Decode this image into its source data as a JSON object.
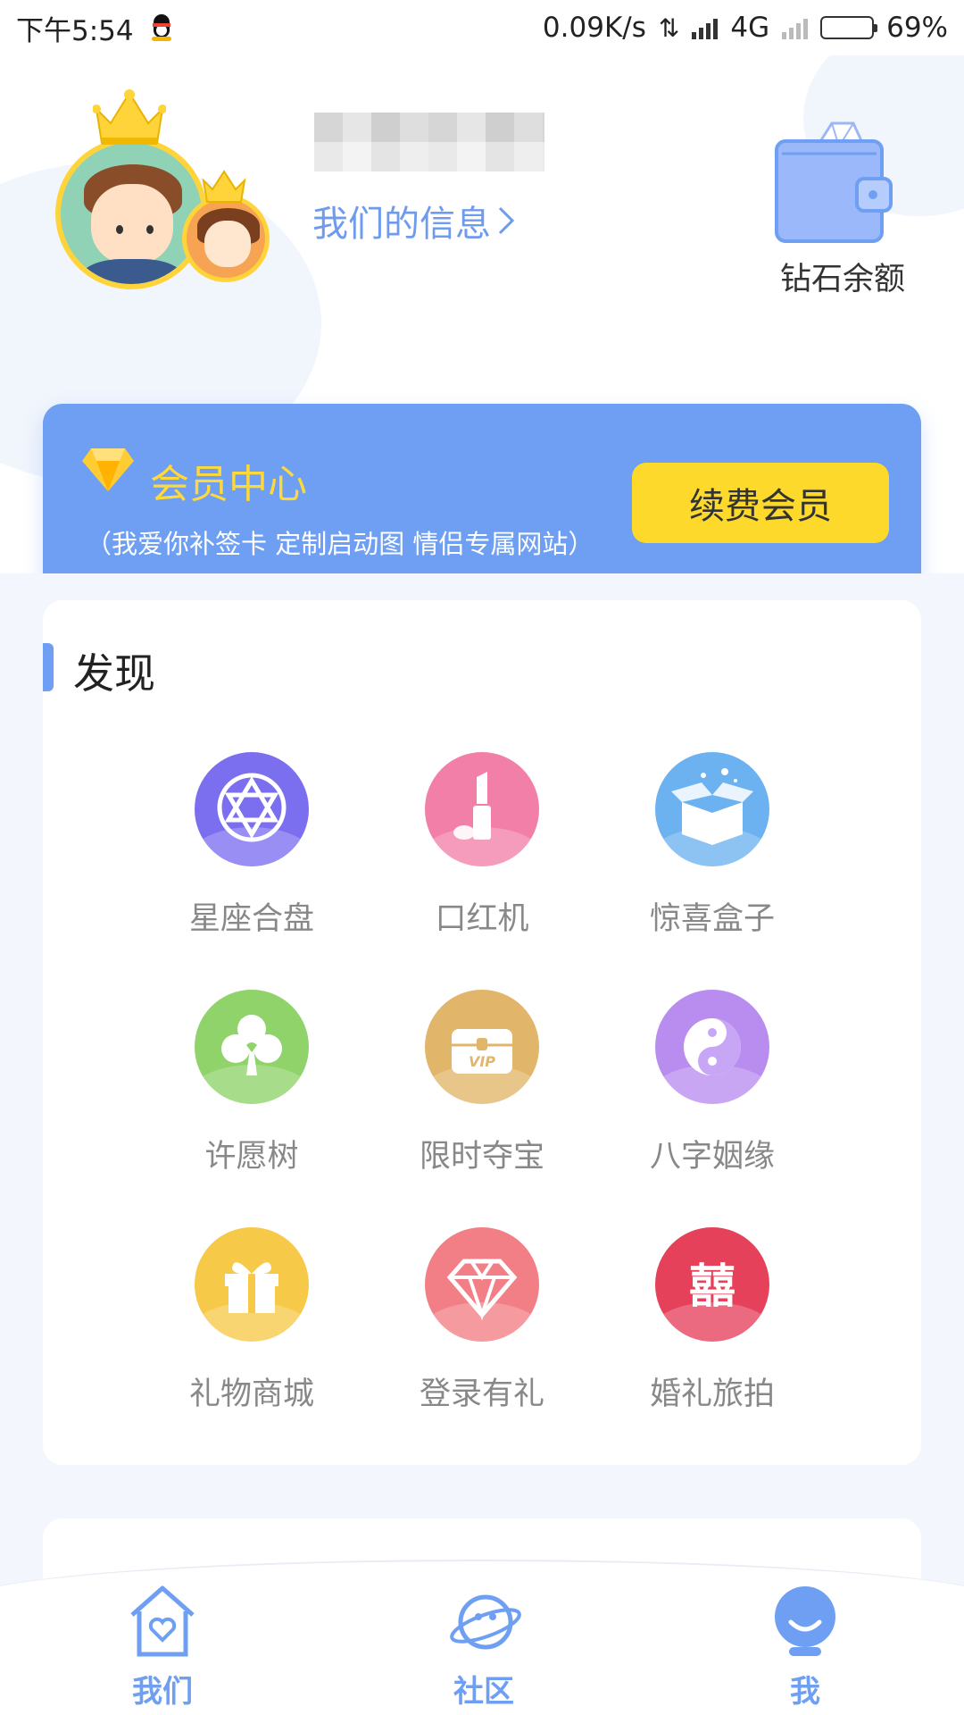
{
  "status_bar": {
    "time": "下午5:54",
    "net_speed": "0.09K/s",
    "network_type": "4G",
    "battery": "69%",
    "battery_level": 0.69
  },
  "profile": {
    "info_link": "我们的信息",
    "wallet_label": "钻石余额"
  },
  "member": {
    "title": "会员中心",
    "subtitle": "（我爱你补签卡 定制启动图 情侣专属网站）",
    "renew_button": "续费会员"
  },
  "discover": {
    "title": "发现",
    "items": [
      {
        "label": "星座合盘",
        "icon": "star-of-david-icon",
        "color": "#7b6ff0"
      },
      {
        "label": "口红机",
        "icon": "lipstick-icon",
        "color": "#f27fa8"
      },
      {
        "label": "惊喜盒子",
        "icon": "gift-box-open-icon",
        "color": "#6cb2f0"
      },
      {
        "label": "许愿树",
        "icon": "clover-icon",
        "color": "#8fd36a"
      },
      {
        "label": "限时夺宝",
        "icon": "vip-chest-icon",
        "color": "#e2b66a"
      },
      {
        "label": "八字姻缘",
        "icon": "yin-yang-icon",
        "color": "#b98df0"
      },
      {
        "label": "礼物商城",
        "icon": "gift-icon",
        "color": "#f7c948"
      },
      {
        "label": "登录有礼",
        "icon": "diamond-icon",
        "color": "#f27f86"
      },
      {
        "label": "婚礼旅拍",
        "icon": "double-happiness-icon",
        "color": "#e6415b"
      }
    ]
  },
  "bottom_nav": {
    "items": [
      {
        "label": "我们",
        "icon": "house-heart-icon"
      },
      {
        "label": "社区",
        "icon": "planet-icon"
      },
      {
        "label": "我",
        "icon": "profile-icon"
      }
    ]
  },
  "colors": {
    "accent": "#6e9ff2",
    "button_yellow": "#fcd92b",
    "member_title": "#ffd83a"
  }
}
